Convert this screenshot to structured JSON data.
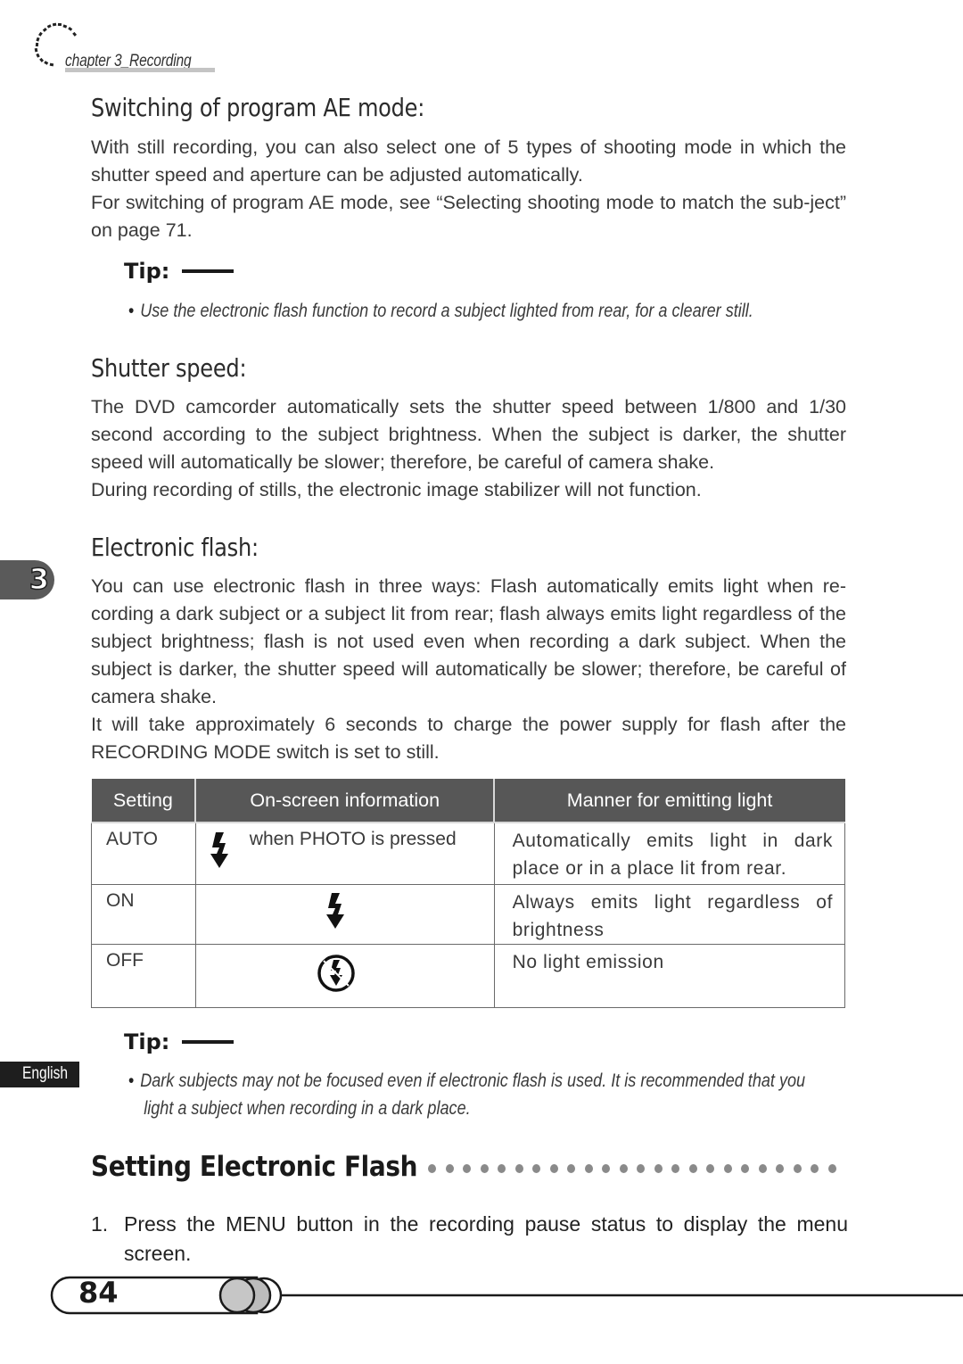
{
  "header": {
    "chapter_label": "chapter 3_Recording"
  },
  "side_tabs": {
    "chapter_number": "3",
    "language": "English"
  },
  "sections": {
    "program_ae": {
      "heading": "Switching of program AE mode:",
      "paragraphs": [
        "With still recording, you can also select one of 5 types of shooting mode in which the shutter speed and aperture can be adjusted automatically.",
        "For switching of program AE mode, see “Selecting shooting mode to match the sub-ject” on page 71."
      ]
    },
    "tip1": {
      "label": "Tip:",
      "bullet": "•",
      "text": "Use the electronic flash function to record a subject lighted from rear, for a clearer still."
    },
    "shutter": {
      "heading": "Shutter speed:",
      "paragraphs": [
        "The DVD camcorder automatically sets the shutter speed between 1/800 and 1/30 second according to the subject brightness. When the subject is darker, the shutter speed will automatically be slower; therefore, be careful of camera shake.",
        "During recording of stills, the electronic image stabilizer will not function."
      ]
    },
    "flash": {
      "heading": "Electronic flash:",
      "paragraphs": [
        "You can use electronic flash in three ways: Flash automatically emits light when re-cording a dark subject or a subject lit from rear; flash always emits light regardless of the subject brightness; flash is not used even when recording a dark subject. When the subject is darker, the shutter speed will automatically be slower; therefore, be careful of camera shake.",
        "It will take approximately 6 seconds to charge the power supply for flash after the RECORDING MODE switch is set to still."
      ]
    },
    "tip2": {
      "label": "Tip:",
      "bullet": "•",
      "lines": [
        "Dark subjects may not be focused even if electronic flash is used. It is recommended that you",
        "light a subject when recording in a dark place."
      ]
    }
  },
  "flash_table": {
    "headers": [
      "Setting",
      "On-screen information",
      "Manner for emitting light"
    ],
    "rows": [
      {
        "setting": "AUTO",
        "icon": "flash-auto-icon",
        "onscreen_text": "when PHOTO is pressed",
        "manner": "Automatically emits light in dark place or in a place lit from rear."
      },
      {
        "setting": "ON",
        "icon": "flash-on-icon",
        "onscreen_text": "",
        "manner": "Always emits light regardless of brightness"
      },
      {
        "setting": "OFF",
        "icon": "flash-off-icon",
        "onscreen_text": "",
        "manner": "No light emission"
      }
    ]
  },
  "setting_section": {
    "heading": "Setting Electronic Flash",
    "steps": [
      {
        "number": "1.",
        "text": "Press the MENU button in the recording pause status to display the menu screen."
      }
    ]
  },
  "footer": {
    "page_number": "84"
  },
  "colors": {
    "table_header_bg": "#575757",
    "tab_bg": "#5a5a5a",
    "lang_tab_bg": "#1e1e1e",
    "dots": "#8a8a8a"
  }
}
